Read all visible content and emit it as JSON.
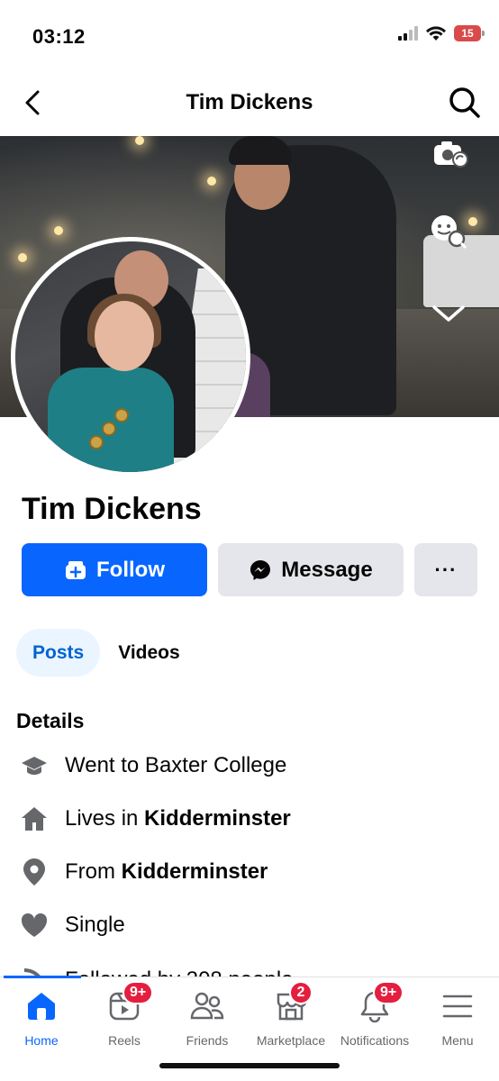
{
  "status_bar": {
    "time": "03:12",
    "battery": "15"
  },
  "header": {
    "title": "Tim Dickens"
  },
  "profile": {
    "name": "Tim Dickens"
  },
  "actions": {
    "follow_label": "Follow",
    "message_label": "Message",
    "more_label": "···"
  },
  "tabs": [
    {
      "label": "Posts",
      "active": true
    },
    {
      "label": "Videos",
      "active": false
    }
  ],
  "details": {
    "title": "Details",
    "education": "Went to Baxter College",
    "lives_prefix": "Lives in ",
    "lives_place": "Kidderminster",
    "from_prefix": "From ",
    "from_place": "Kidderminster",
    "relationship": "Single",
    "followed_by": "Followed by 308 people"
  },
  "nav": [
    {
      "label": "Home",
      "badge": ""
    },
    {
      "label": "Reels",
      "badge": "9+"
    },
    {
      "label": "Friends",
      "badge": ""
    },
    {
      "label": "Marketplace",
      "badge": "2"
    },
    {
      "label": "Notifications",
      "badge": "9+"
    },
    {
      "label": "Menu",
      "badge": ""
    }
  ],
  "colors": {
    "primary": "#0866ff",
    "badge": "#e41e3f",
    "button_grey": "#e4e6eb",
    "tab_active_bg": "#ebf5ff"
  }
}
